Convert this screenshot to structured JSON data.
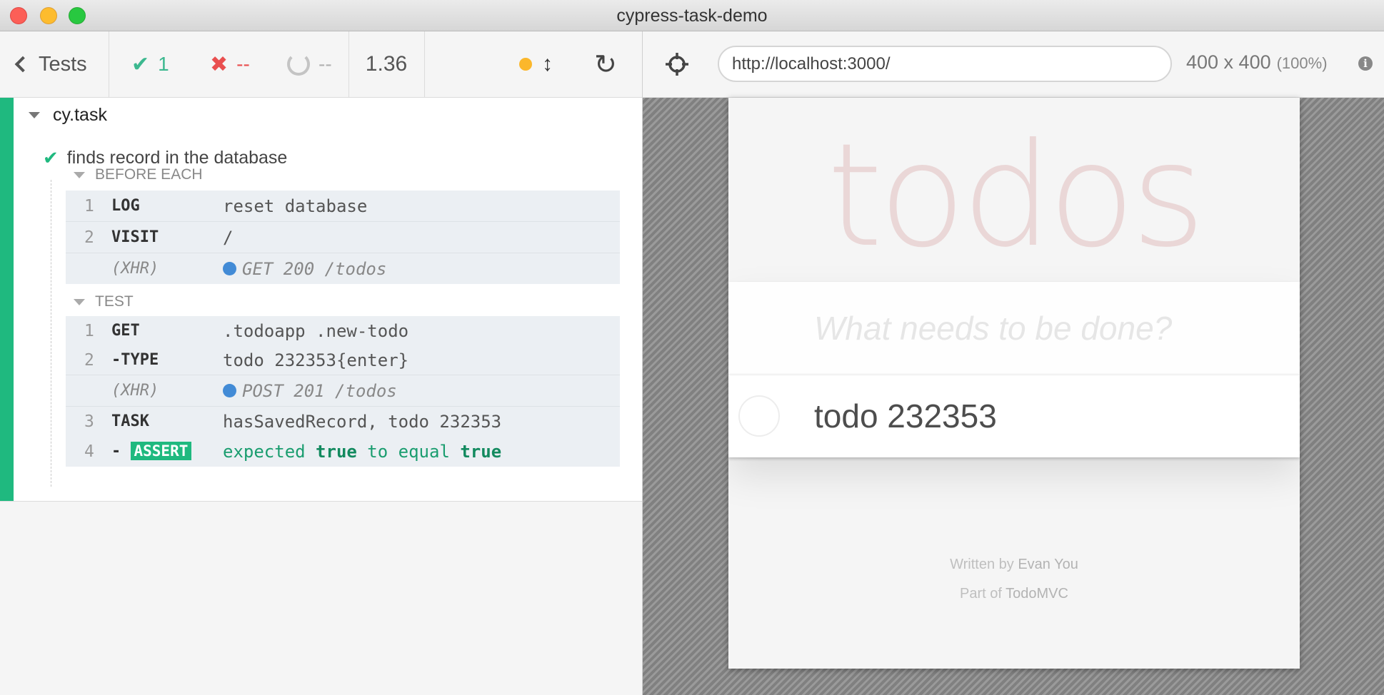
{
  "window": {
    "title": "cypress-task-demo"
  },
  "reporter_header": {
    "tests_label": "Tests",
    "passed_count": "1",
    "failed_count": "--",
    "pending_count": "--",
    "duration": "1.36"
  },
  "runnables": {
    "suite_title": "cy.task",
    "test_title": "finds record in the database",
    "before_each": {
      "title": "BEFORE EACH",
      "commands": [
        {
          "num": "1",
          "name": "LOG",
          "message": "reset database"
        },
        {
          "num": "2",
          "name": "VISIT",
          "message": "/"
        },
        {
          "num": "",
          "name": "(XHR)",
          "message": "GET 200 /todos"
        }
      ]
    },
    "test_hook": {
      "title": "TEST",
      "commands": [
        {
          "num": "1",
          "name": "GET",
          "message": ".todoapp .new-todo"
        },
        {
          "num": "2",
          "name": "-TYPE",
          "message": "todo 232353{enter}"
        },
        {
          "num": "",
          "name": "(XHR)",
          "message": "POST 201 /todos"
        },
        {
          "num": "3",
          "name": "TASK",
          "message": "hasSavedRecord, todo 232353"
        },
        {
          "num": "4",
          "name": "ASSERT",
          "prefix": "-",
          "message_parts": [
            "expected",
            "true",
            "to equal",
            "true"
          ]
        }
      ]
    }
  },
  "aut_header": {
    "url": "http://localhost:3000/",
    "viewport": "400 x 400",
    "zoom": "(100%)"
  },
  "app": {
    "title": "todos",
    "new_todo_placeholder": "What needs to be done?",
    "todos": [
      {
        "label": "todo 232353",
        "completed": false
      }
    ],
    "footer": {
      "written_by_prefix": "Written by",
      "author": "Evan You",
      "part_of_prefix": "Part of",
      "project": "TodoMVC"
    }
  },
  "colors": {
    "passed": "#1fb97f",
    "failed": "#e94f4f",
    "xhr_dot": "#428bd6",
    "running_dot": "#fbb72b"
  }
}
